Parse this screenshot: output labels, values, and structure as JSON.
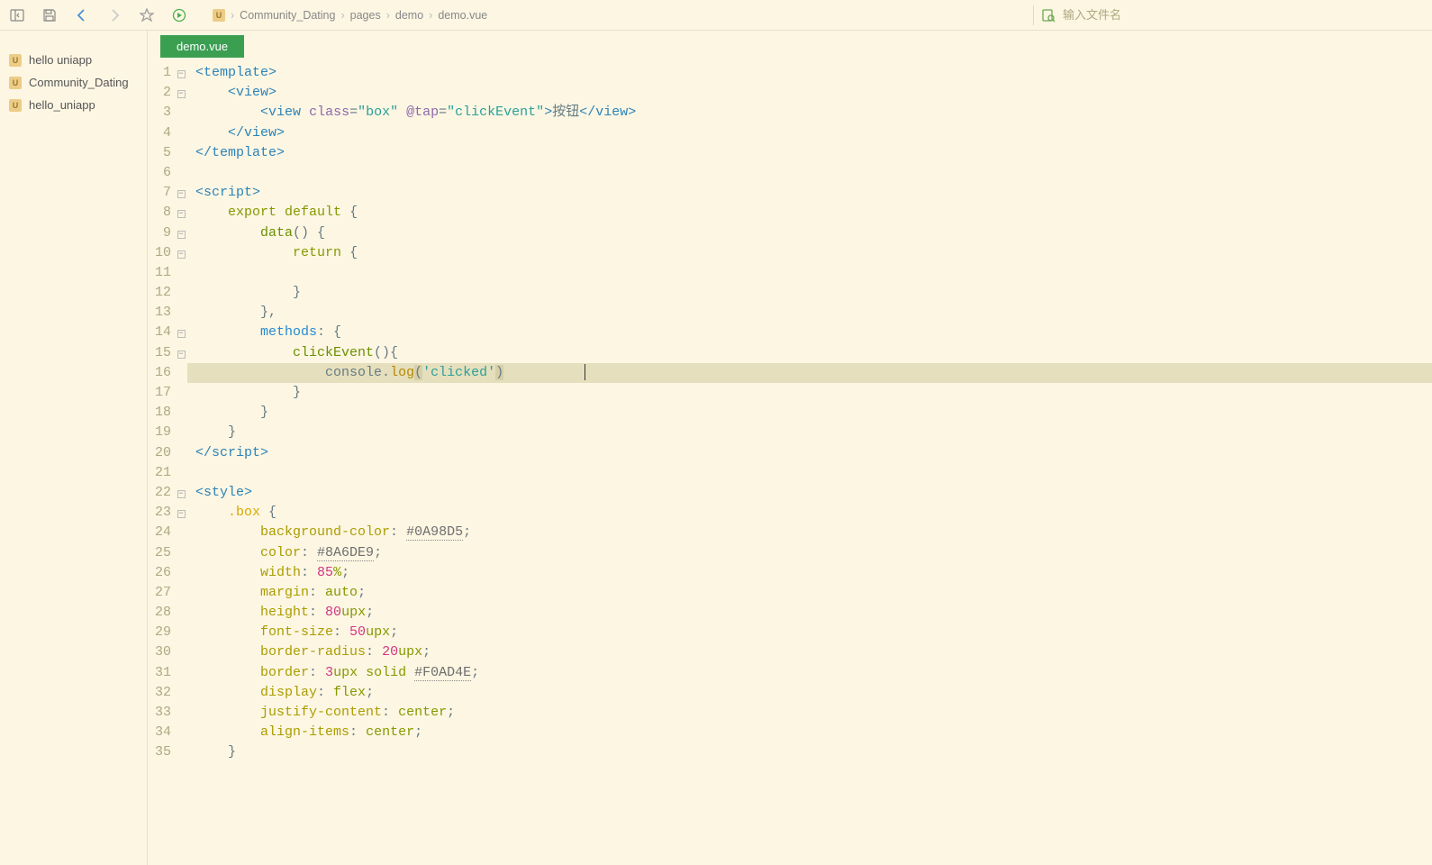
{
  "toolbar": {
    "search_placeholder": "输入文件名"
  },
  "breadcrumb": {
    "items": [
      "Community_Dating",
      "pages",
      "demo",
      "demo.vue"
    ]
  },
  "sidebar": {
    "items": [
      {
        "label": "hello uniapp"
      },
      {
        "label": "Community_Dating"
      },
      {
        "label": "hello_uniapp"
      }
    ]
  },
  "tab": {
    "active": "demo.vue"
  },
  "code": {
    "lines": [
      {
        "n": 1,
        "fold": true
      },
      {
        "n": 2,
        "fold": true
      },
      {
        "n": 3,
        "fold": false
      },
      {
        "n": 4,
        "fold": false
      },
      {
        "n": 5,
        "fold": false
      },
      {
        "n": 6,
        "fold": false
      },
      {
        "n": 7,
        "fold": true
      },
      {
        "n": 8,
        "fold": true
      },
      {
        "n": 9,
        "fold": true
      },
      {
        "n": 10,
        "fold": true
      },
      {
        "n": 11,
        "fold": false
      },
      {
        "n": 12,
        "fold": false
      },
      {
        "n": 13,
        "fold": false
      },
      {
        "n": 14,
        "fold": true
      },
      {
        "n": 15,
        "fold": true
      },
      {
        "n": 16,
        "fold": false,
        "hl": true
      },
      {
        "n": 17,
        "fold": false
      },
      {
        "n": 18,
        "fold": false
      },
      {
        "n": 19,
        "fold": false
      },
      {
        "n": 20,
        "fold": false
      },
      {
        "n": 21,
        "fold": false
      },
      {
        "n": 22,
        "fold": true
      },
      {
        "n": 23,
        "fold": true
      },
      {
        "n": 24,
        "fold": false
      },
      {
        "n": 25,
        "fold": false
      },
      {
        "n": 26,
        "fold": false
      },
      {
        "n": 27,
        "fold": false
      },
      {
        "n": 28,
        "fold": false
      },
      {
        "n": 29,
        "fold": false
      },
      {
        "n": 30,
        "fold": false
      },
      {
        "n": 31,
        "fold": false
      },
      {
        "n": 32,
        "fold": false
      },
      {
        "n": 33,
        "fold": false
      },
      {
        "n": 34,
        "fold": false
      },
      {
        "n": 35,
        "fold": false
      }
    ],
    "content": {
      "l1_tag": "template",
      "l2_tag": "view",
      "l3_tag": "view",
      "l3_attr1": "class",
      "l3_val1": "\"box\"",
      "l3_attr2": "@tap",
      "l3_val2": "\"clickEvent\"",
      "l3_text": "按钮",
      "l7_tag": "script",
      "l8_kw1": "export",
      "l8_kw2": "default",
      "l9_fn": "data",
      "l10_kw": "return",
      "l14_prop": "methods",
      "l15_fn": "clickEvent",
      "l16_obj": "console",
      "l16_method": "log",
      "l16_str": "'clicked'",
      "l22_tag": "style",
      "l23_sel": ".box",
      "l24_prop": "background-color",
      "l24_val": "#0A98D5",
      "l25_prop": "color",
      "l25_val": "#8A6DE9",
      "l26_prop": "width",
      "l26_val": "85",
      "l26_unit": "%",
      "l27_prop": "margin",
      "l27_val": "auto",
      "l28_prop": "height",
      "l28_val": "80",
      "l28_unit": "upx",
      "l29_prop": "font-size",
      "l29_val": "50",
      "l29_unit": "upx",
      "l30_prop": "border-radius",
      "l30_val": "20",
      "l30_unit": "upx",
      "l31_prop": "border",
      "l31_val1": "3",
      "l31_unit": "upx",
      "l31_val2": "solid",
      "l31_color": "#F0AD4E",
      "l32_prop": "display",
      "l32_val": "flex",
      "l33_prop": "justify-content",
      "l33_val": "center",
      "l34_prop": "align-items",
      "l34_val": "center"
    }
  }
}
